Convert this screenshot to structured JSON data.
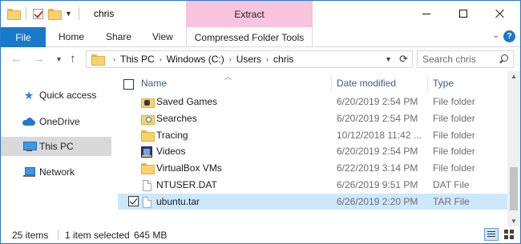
{
  "window": {
    "title": "chris",
    "contextual_group": "Extract",
    "contextual_group_color": "#f8c3dd",
    "accent_color": "#1979ca"
  },
  "ribbon": {
    "file": "File",
    "tabs": [
      "Home",
      "Share",
      "View"
    ],
    "contextual_tab": "Compressed Folder Tools"
  },
  "address_bar": {
    "crumbs": [
      "This PC",
      "Windows (C:)",
      "Users",
      "chris"
    ],
    "search_placeholder": "Search chris"
  },
  "nav_pane": {
    "items": [
      {
        "label": "Quick access",
        "icon": "star-icon"
      },
      {
        "label": "OneDrive",
        "icon": "cloud-icon"
      },
      {
        "label": "This PC",
        "icon": "pc-icon",
        "selected": true
      },
      {
        "label": "Network",
        "icon": "network-icon"
      }
    ]
  },
  "file_list": {
    "columns": {
      "name": "Name",
      "date_modified": "Date modified",
      "type": "Type"
    },
    "rows": [
      {
        "name": "Saved Games",
        "date": "6/20/2019 2:54 PM",
        "type": "File folder",
        "icon": "saved-games-folder-icon"
      },
      {
        "name": "Searches",
        "date": "6/20/2019 2:54 PM",
        "type": "File folder",
        "icon": "searches-folder-icon"
      },
      {
        "name": "Tracing",
        "date": "10/12/2018 11:42 ...",
        "type": "File folder",
        "icon": "folder-icon"
      },
      {
        "name": "Videos",
        "date": "6/20/2019 2:54 PM",
        "type": "File folder",
        "icon": "videos-folder-icon"
      },
      {
        "name": "VirtualBox VMs",
        "date": "6/22/2019 3:14 PM",
        "type": "File folder",
        "icon": "folder-icon"
      },
      {
        "name": "NTUSER.DAT",
        "date": "6/26/2019 9:51 PM",
        "type": "DAT File",
        "icon": "file-icon"
      },
      {
        "name": "ubuntu.tar",
        "date": "6/26/2019 2:20 PM",
        "type": "TAR File",
        "icon": "file-icon",
        "selected": true,
        "checked": true
      }
    ]
  },
  "status_bar": {
    "item_count": "25 items",
    "selection": "1 item selected",
    "size": "645 MB"
  }
}
